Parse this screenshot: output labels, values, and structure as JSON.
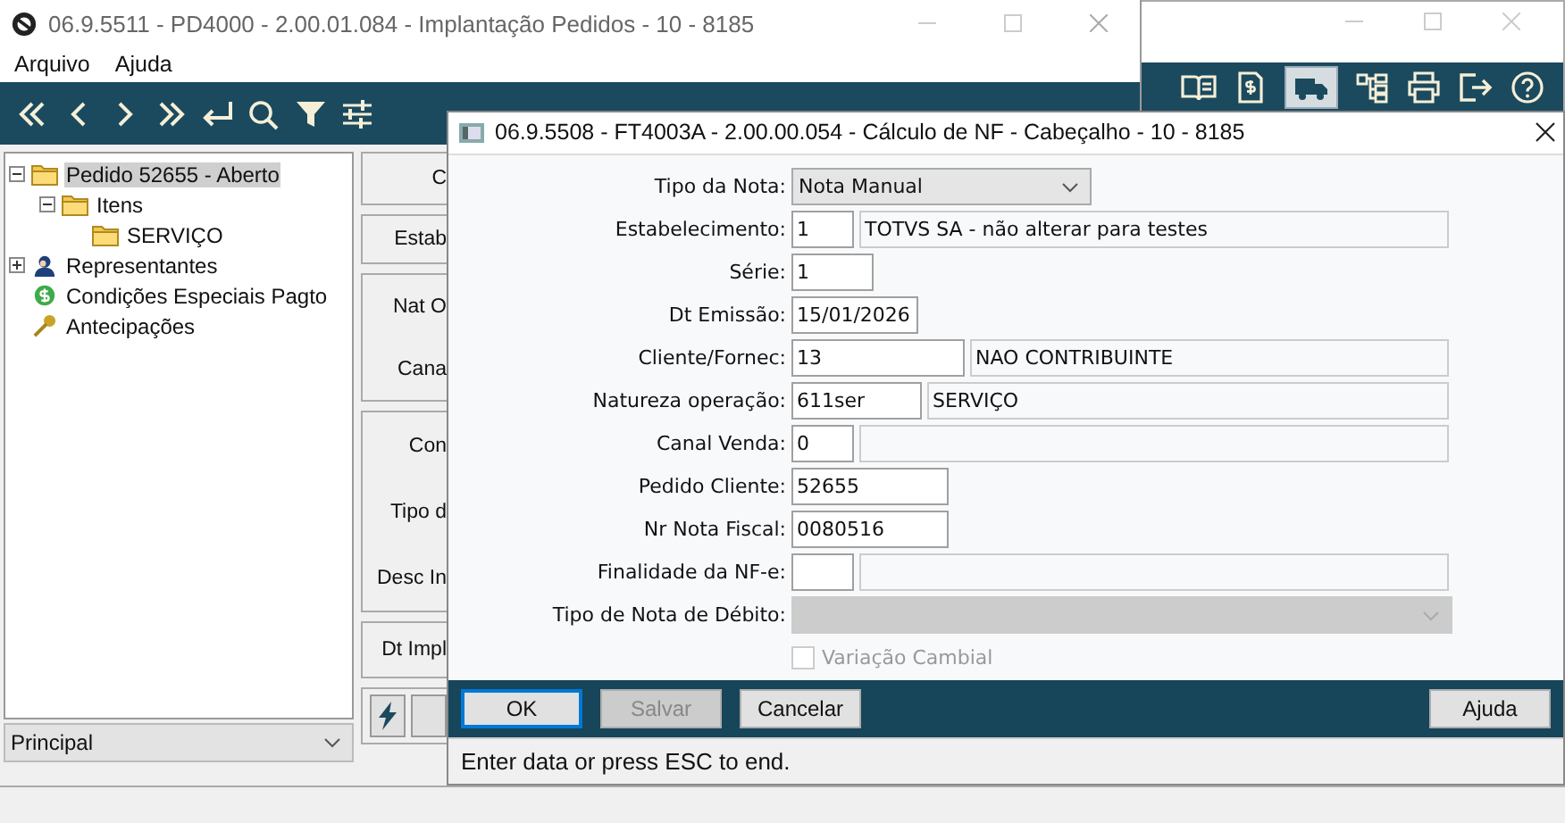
{
  "main_window": {
    "title": "06.9.5511 - PD4000 - 2.00.01.084 - Implantação Pedidos - 10 - 8185",
    "menu": [
      "Arquivo",
      "Ajuda"
    ],
    "tree": [
      {
        "label": "Pedido 52655 - Aberto",
        "kind": "folder",
        "expanded": true,
        "selected": true,
        "children": [
          {
            "label": "Itens",
            "kind": "folder",
            "expanded": true,
            "selected": false,
            "children": [
              {
                "label": "SERVIÇO",
                "kind": "folder",
                "selected": false
              }
            ]
          }
        ]
      },
      {
        "label": "Representantes",
        "kind": "person",
        "expanded": false,
        "selected": false
      },
      {
        "label": "Condições Especiais Pagto",
        "kind": "money",
        "selected": false
      },
      {
        "label": "Antecipações",
        "kind": "key",
        "selected": false
      }
    ],
    "view_select": {
      "value": "Principal"
    },
    "side_labels": [
      [
        "C"
      ],
      [
        "Estab"
      ],
      [
        "Nat O",
        "Cana"
      ],
      [
        "Con",
        "Tipo d",
        "Desc In"
      ],
      [
        "Dt Impl"
      ]
    ]
  },
  "dialog": {
    "title": "06.9.5508 - FT4003A - 2.00.00.054 - Cálculo de NF - Cabeçalho - 10 - 8185",
    "fields": [
      {
        "kind": "select",
        "label": "Tipo da Nota:",
        "value": "Nota Manual",
        "disabled": false
      },
      {
        "kind": "code_desc",
        "label": "Estabelecimento:",
        "value": "1",
        "description": "TOTVS SA - não alterar para testes"
      },
      {
        "kind": "text",
        "label": "Série:",
        "value": "1"
      },
      {
        "kind": "text",
        "label": "Dt Emissão:",
        "value": "15/01/2026"
      },
      {
        "kind": "code_desc",
        "label": "Cliente/Fornec:",
        "value": "13",
        "description": "NAO CONTRIBUINTE"
      },
      {
        "kind": "code_desc",
        "label": "Natureza operação:",
        "value": "611ser",
        "description": "SERVIÇO"
      },
      {
        "kind": "code_desc",
        "label": "Canal Venda:",
        "value": "0"
      },
      {
        "kind": "text",
        "label": "Pedido Cliente:",
        "value": "52655"
      },
      {
        "kind": "text",
        "label": "Nr Nota Fiscal:",
        "value": "0080516"
      },
      {
        "kind": "code_desc",
        "label": "Finalidade da NF-e:"
      },
      {
        "kind": "select",
        "label": "Tipo de Nota de Débito:",
        "disabled": true
      }
    ],
    "checkbox": {
      "label": "Variação Cambial",
      "checked": false,
      "disabled": true
    },
    "buttons": [
      {
        "label": "OK",
        "disabled": false,
        "default": true
      },
      {
        "label": "Salvar",
        "disabled": true,
        "default": false
      },
      {
        "label": "Cancelar",
        "disabled": false,
        "default": false
      },
      {
        "label": "Ajuda",
        "disabled": false,
        "default": false
      }
    ],
    "status": "Enter data or press ESC to end."
  }
}
